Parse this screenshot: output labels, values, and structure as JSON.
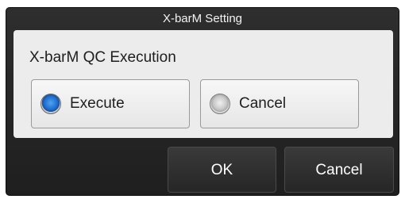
{
  "dialog": {
    "title": "X-barM Setting"
  },
  "section": {
    "label": "X-barM QC Execution"
  },
  "options": [
    {
      "label": "Execute",
      "selected": true
    },
    {
      "label": "Cancel",
      "selected": false
    }
  ],
  "footer": {
    "ok_label": "OK",
    "cancel_label": "Cancel"
  },
  "colors": {
    "dialog_background": "#262626",
    "panel_background": "#ececec",
    "radio_selected": "#1f6fd0"
  }
}
